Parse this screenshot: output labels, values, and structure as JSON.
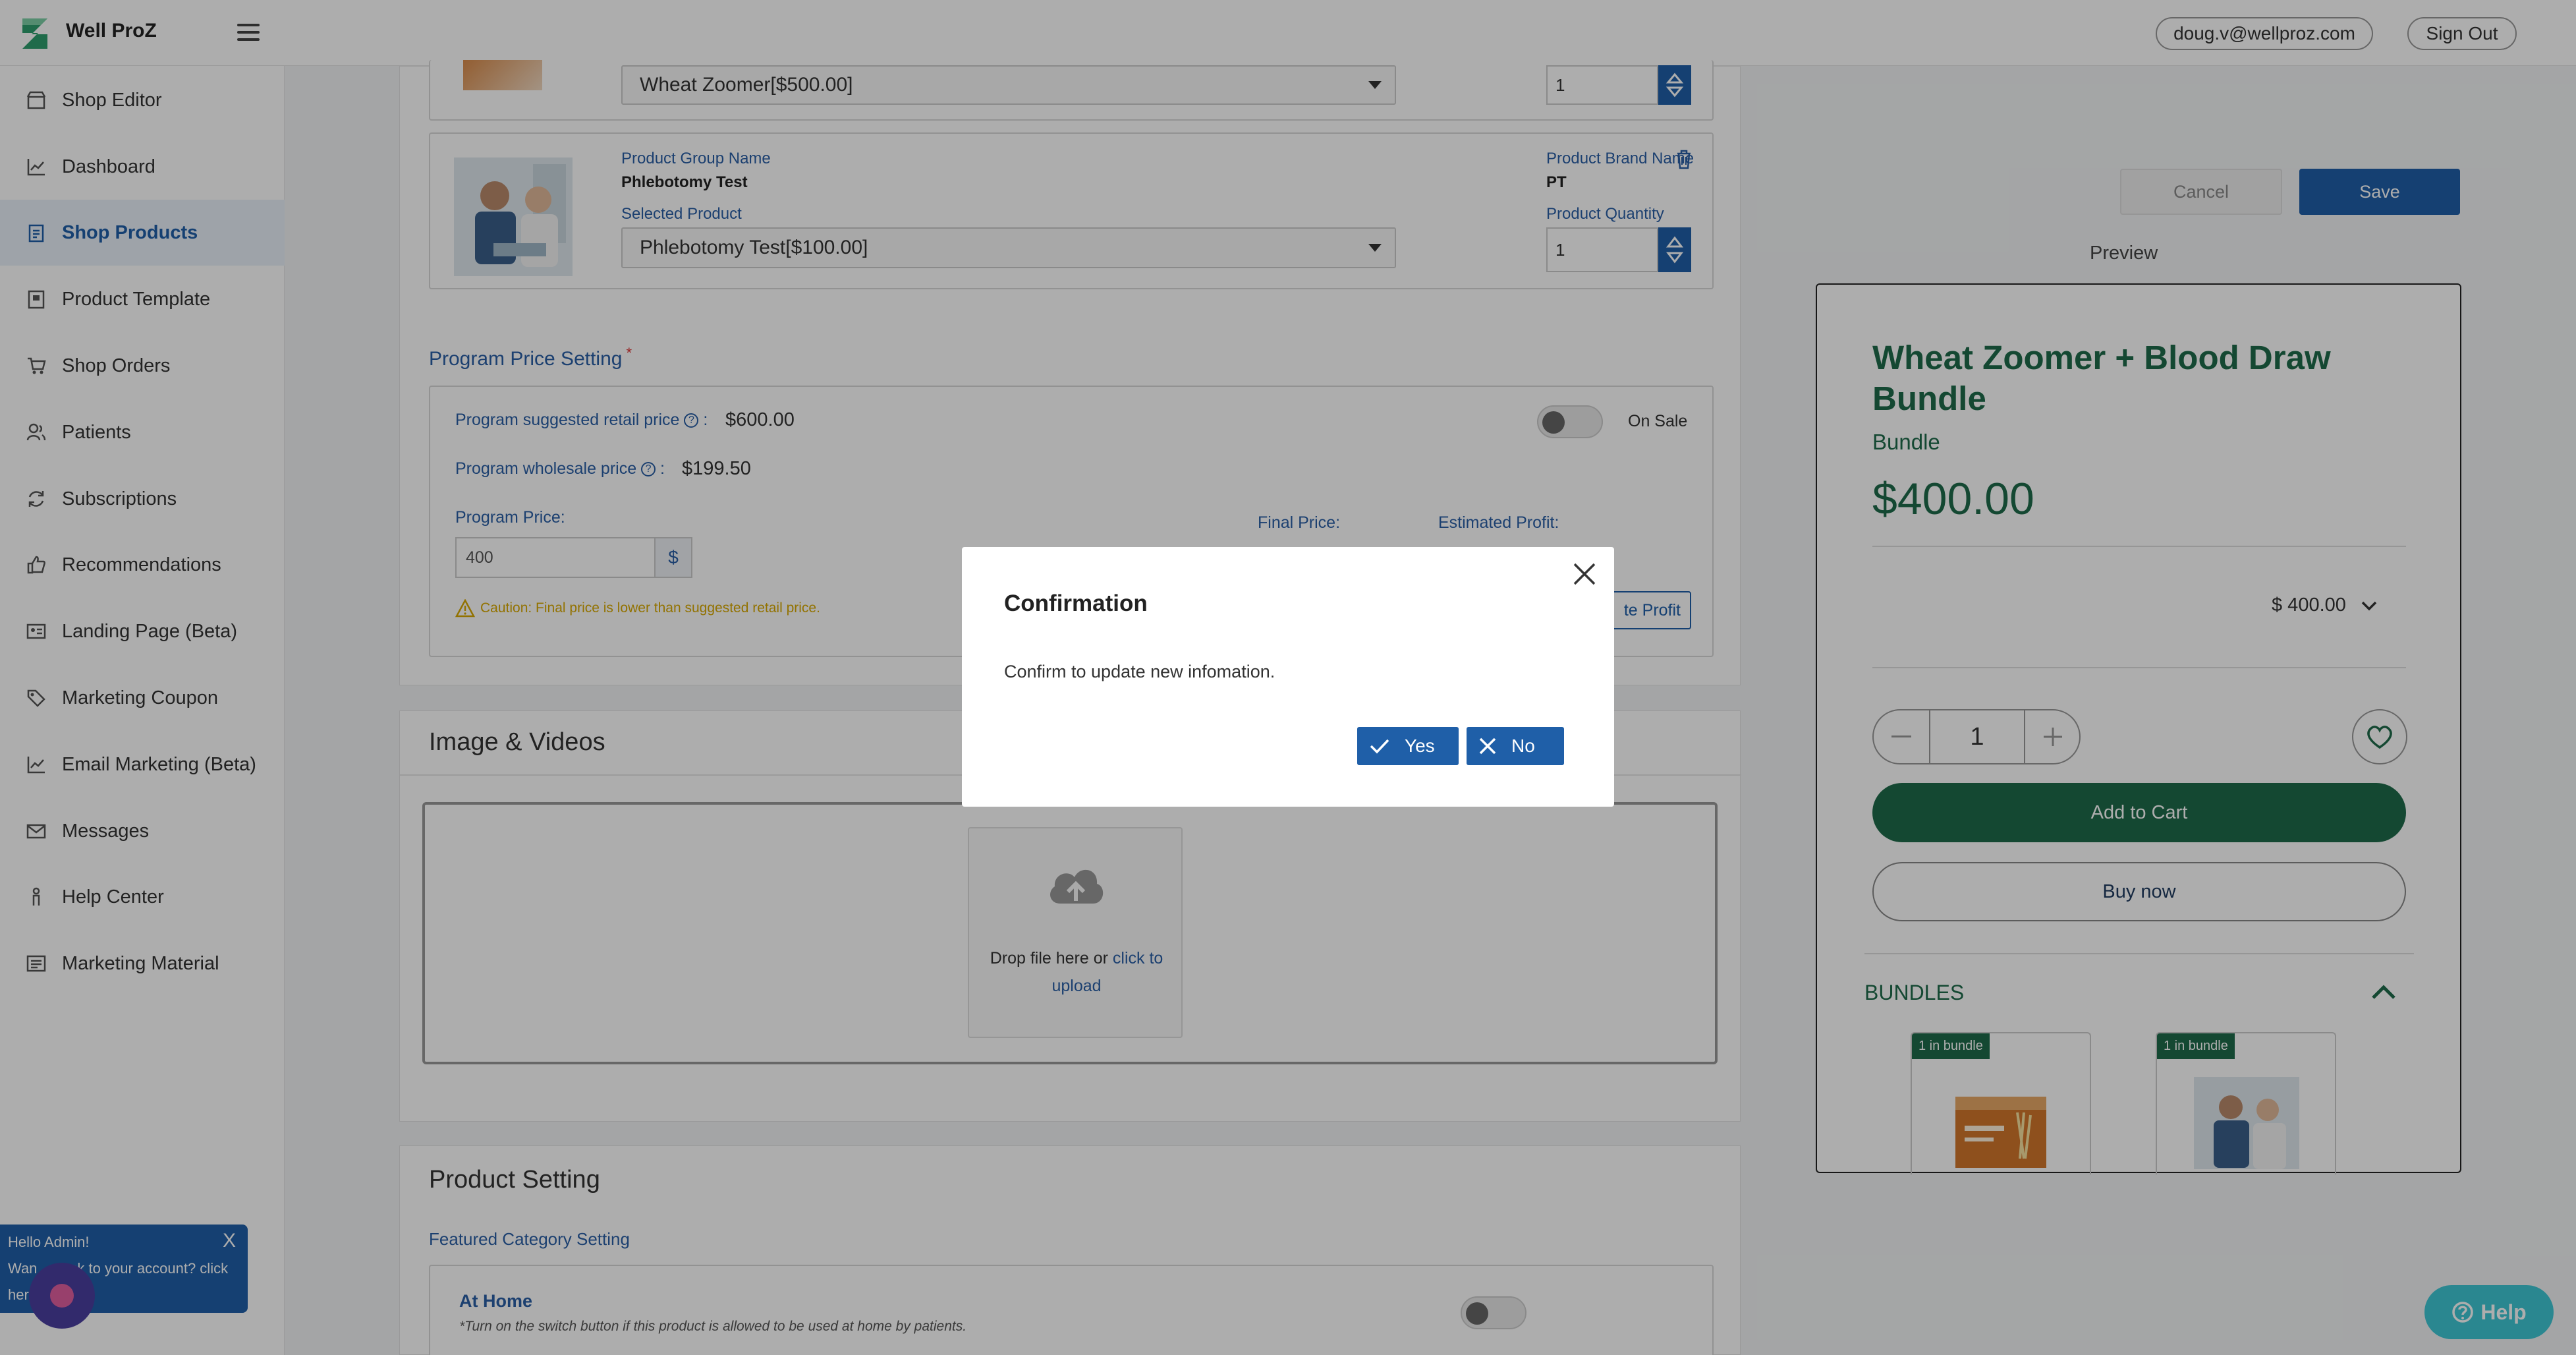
{
  "app": {
    "brand": "Well ProZ"
  },
  "header": {
    "email": "doug.v@wellproz.com",
    "sign_out": "Sign Out"
  },
  "sidebar": {
    "items": [
      {
        "label": "Shop Editor",
        "icon": "store-icon"
      },
      {
        "label": "Dashboard",
        "icon": "chart-line-icon"
      },
      {
        "label": "Shop Products",
        "icon": "clipboard-icon",
        "active": true
      },
      {
        "label": "Product Template",
        "icon": "template-icon"
      },
      {
        "label": "Shop Orders",
        "icon": "cart-icon"
      },
      {
        "label": "Patients",
        "icon": "users-icon"
      },
      {
        "label": "Subscriptions",
        "icon": "refresh-icon"
      },
      {
        "label": "Recommendations",
        "icon": "thumbs-up-icon"
      },
      {
        "label": "Landing Page (Beta)",
        "icon": "landing-icon"
      },
      {
        "label": "Marketing Coupon",
        "icon": "tag-icon"
      },
      {
        "label": "Email Marketing (Beta)",
        "icon": "chart-line-icon"
      },
      {
        "label": "Messages",
        "icon": "mail-icon"
      },
      {
        "label": "Help Center",
        "icon": "person-icon"
      },
      {
        "label": "Marketing Material",
        "icon": "list-icon"
      }
    ]
  },
  "products": {
    "first_select": "Wheat Zoomer[$500.00]",
    "first_qty": "1",
    "group_label": "Product Group Name",
    "group_value": "Phlebotomy Test",
    "brand_label": "Product Brand Name",
    "brand_value": "PT",
    "selected_label": "Selected Product",
    "selected_value": "Phlebotomy Test[$100.00]",
    "qty_label": "Product Quantity",
    "qty_value": "1"
  },
  "pricing": {
    "title": "Program Price Setting",
    "required_mark": "*",
    "retail_label": "Program suggested retail price",
    "retail_suffix": ":",
    "retail_value": "$600.00",
    "wholesale_label": "Program wholesale price",
    "wholesale_suffix": ":",
    "wholesale_value": "$199.50",
    "on_sale": "On Sale",
    "program_price_label": "Program Price:",
    "program_price_value": "400",
    "currency": "$",
    "final_price_label": "Final Price:",
    "profit_label": "Estimated Profit:",
    "caution": "Caution: Final price is lower than suggested retail price.",
    "profit_button": "te Profit"
  },
  "media": {
    "title": "Image & Videos",
    "drop_text": "Drop file here or",
    "upload_link": "click to upload"
  },
  "settings": {
    "title": "Product Setting",
    "featured": "Featured Category Setting",
    "at_home": "At Home",
    "at_home_note": "*Turn on the switch button if this product is allowed to be used at home by patients."
  },
  "actions": {
    "cancel": "Cancel",
    "save": "Save",
    "preview": "Preview"
  },
  "preview": {
    "title": "Wheat Zoomer + Blood Draw Bundle",
    "subtitle": "Bundle",
    "price": "$400.00",
    "option_price": "$ 400.00",
    "qty": "1",
    "add_to_cart": "Add to Cart",
    "buy_now": "Buy now",
    "bundles": "BUNDLES",
    "badge1": "1 in bundle",
    "badge2": "1 in bundle"
  },
  "modal": {
    "title": "Confirmation",
    "message": "Confirm to update new infomation.",
    "yes": "Yes",
    "no": "No"
  },
  "toast": {
    "line1": "Hello Admin!",
    "line2": "Wan",
    "line2b": "ck to your account? click",
    "line3": "her",
    "close": "X"
  },
  "help": {
    "label": "Help"
  },
  "colors": {
    "primary": "#1f5fa8",
    "brand_green": "#1e6b4a",
    "help": "#3ec7d4"
  }
}
